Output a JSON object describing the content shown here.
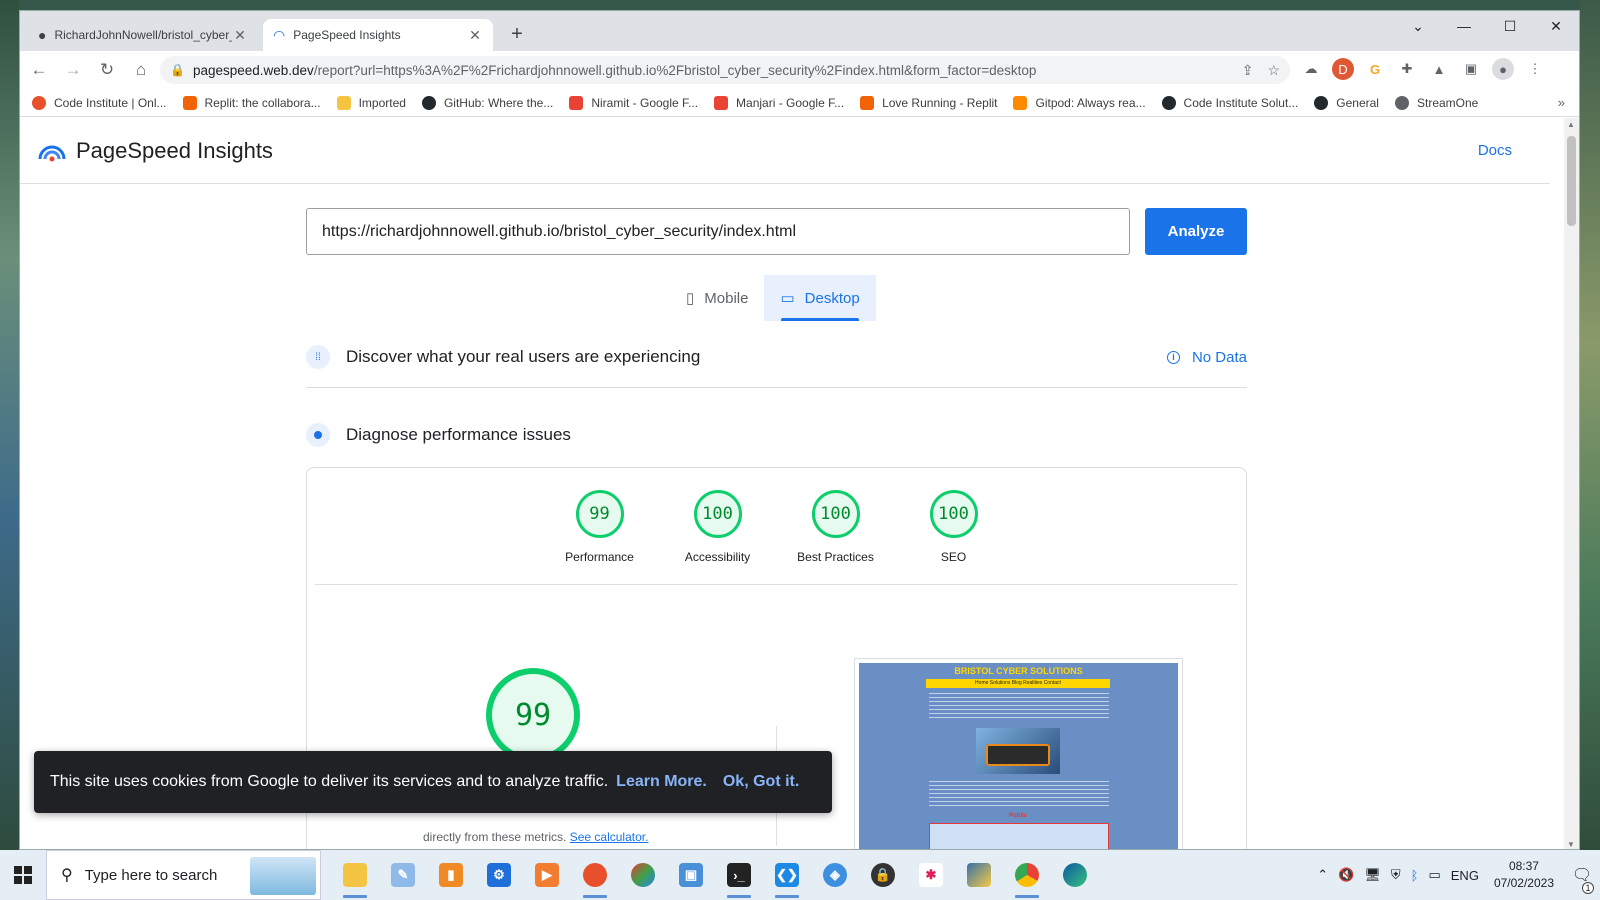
{
  "browser": {
    "tabs": [
      {
        "title": "RichardJohnNowell/bristol_cyber_security",
        "active": false
      },
      {
        "title": "PageSpeed Insights",
        "active": true
      }
    ],
    "url_host": "pagespeed.web.dev",
    "url_path": "/report?url=https%3A%2F%2Frichardjohnnowell.github.io%2Fbristol_cyber_security%2Findex.html&form_factor=desktop",
    "bookmarks": [
      {
        "label": "Code Institute | Onl...",
        "color": "#e8502b"
      },
      {
        "label": "Replit: the collabora...",
        "color": "#f26207"
      },
      {
        "label": "Imported",
        "color": "#f4c542"
      },
      {
        "label": "GitHub: Where the...",
        "color": "#24292e"
      },
      {
        "label": "Niramit - Google F...",
        "color": "#ea4335"
      },
      {
        "label": "Manjari - Google F...",
        "color": "#ea4335"
      },
      {
        "label": "Love Running - Replit",
        "color": "#f26207"
      },
      {
        "label": "Gitpod: Always rea...",
        "color": "#ff8a00"
      },
      {
        "label": "Code Institute Solut...",
        "color": "#24292e"
      },
      {
        "label": "General",
        "color": "#24292e"
      },
      {
        "label": "StreamOne",
        "color": "#5f6368"
      }
    ]
  },
  "psi": {
    "title": "PageSpeed Insights",
    "docs": "Docs",
    "input_url": "https://richardjohnnowell.github.io/bristol_cyber_security/index.html",
    "analyze": "Analyze",
    "mobile_tab": "Mobile",
    "desktop_tab": "Desktop",
    "real_users": "Discover what your real users are experiencing",
    "no_data": "No Data",
    "diagnose": "Diagnose performance issues",
    "scores": [
      {
        "value": "99",
        "label": "Performance"
      },
      {
        "value": "100",
        "label": "Accessibility"
      },
      {
        "value": "100",
        "label": "Best Practices"
      },
      {
        "value": "100",
        "label": "SEO"
      }
    ],
    "big_score": "99",
    "calc_text": "directly from these metrics.",
    "calc_link": "See calculator.",
    "thumb_title": "BRISTOL CYBER SOLUTIONS",
    "thumb_nav": "Home  Solutions  Blog  Realities  Contact",
    "thumb_red": "Public"
  },
  "cookie": {
    "text": "This site uses cookies from Google to deliver its services and to analyze traffic.",
    "learn_more": "Learn More.",
    "ok": "Ok, Got it."
  },
  "taskbar": {
    "search_placeholder": "Type here to search",
    "lang": "ENG",
    "time": "08:37",
    "date": "07/02/2023",
    "notifications": "1"
  },
  "colors": {
    "accent": "#1a73e8",
    "pass_green": "#0cce6b",
    "pass_text": "#008a2e"
  }
}
